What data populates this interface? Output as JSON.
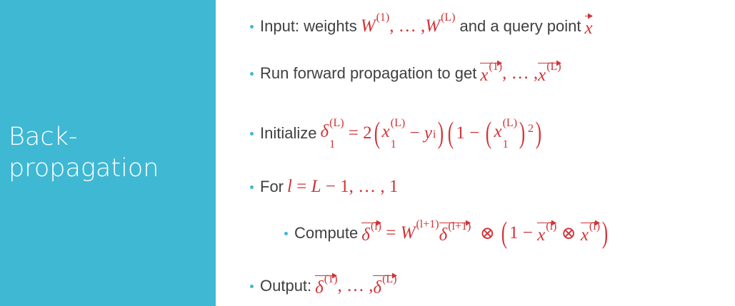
{
  "slide": {
    "title": "Back-\npropagation",
    "accent_color": "#3fb8d3",
    "math_color": "#d13438",
    "bullets": [
      {
        "label": "Input: weights",
        "math": [
          {
            "b": "W",
            "sup": "(1)"
          },
          ", … ,",
          {
            "b": "W",
            "sup": "(L)"
          }
        ],
        "label2": "and a query point",
        "math2": [
          {
            "b": "x",
            "vec": true
          }
        ]
      },
      {
        "label": "Run forward propagation to get",
        "math": [
          {
            "b": "x",
            "sup": "(1)",
            "vec": true
          },
          ", … ,",
          {
            "b": "x",
            "sup": "(L)",
            "vec": true
          }
        ]
      },
      {
        "label": "Initialize",
        "math": [
          {
            "b": "δ",
            "sup": "(L)",
            "sub": "1"
          },
          " = 2",
          {
            "p": "("
          },
          {
            "b": "x",
            "sup": "(L)",
            "sub": "1"
          },
          " − ",
          {
            "b": "y",
            "sub": "i"
          },
          {
            "p": ")"
          },
          {
            "p": "("
          },
          "1 − ",
          {
            "p": "("
          },
          {
            "b": "x",
            "sup": "(L)",
            "sub": "1"
          },
          {
            "p": ")"
          },
          {
            "b": "",
            "sup": "2"
          },
          {
            "p": ")"
          }
        ]
      },
      {
        "label": "For",
        "math": [
          {
            "b": "l"
          },
          " = ",
          {
            "b": "L"
          },
          " − 1, … , 1"
        ]
      },
      {
        "label": "Compute",
        "sub": true,
        "math": [
          {
            "b": "δ",
            "sup": "(l)",
            "vec": true
          },
          " = ",
          {
            "b": "W",
            "sup": "(l+1)"
          },
          {
            "b": "δ",
            "sup": "(l+1)",
            "vec": true
          },
          "  ⊗ ",
          {
            "p": "("
          },
          "1 − ",
          {
            "b": "x",
            "sup": "(l)",
            "vec": true
          },
          " ⊗ ",
          {
            "b": "x",
            "sup": "(l)",
            "vec": true
          },
          {
            "p": ")"
          }
        ]
      },
      {
        "label": "Output:",
        "math": [
          {
            "b": "δ",
            "sup": "(1)",
            "vec": true
          },
          ", … ,",
          {
            "b": "δ",
            "sup": "(L)",
            "vec": true
          }
        ]
      }
    ]
  }
}
